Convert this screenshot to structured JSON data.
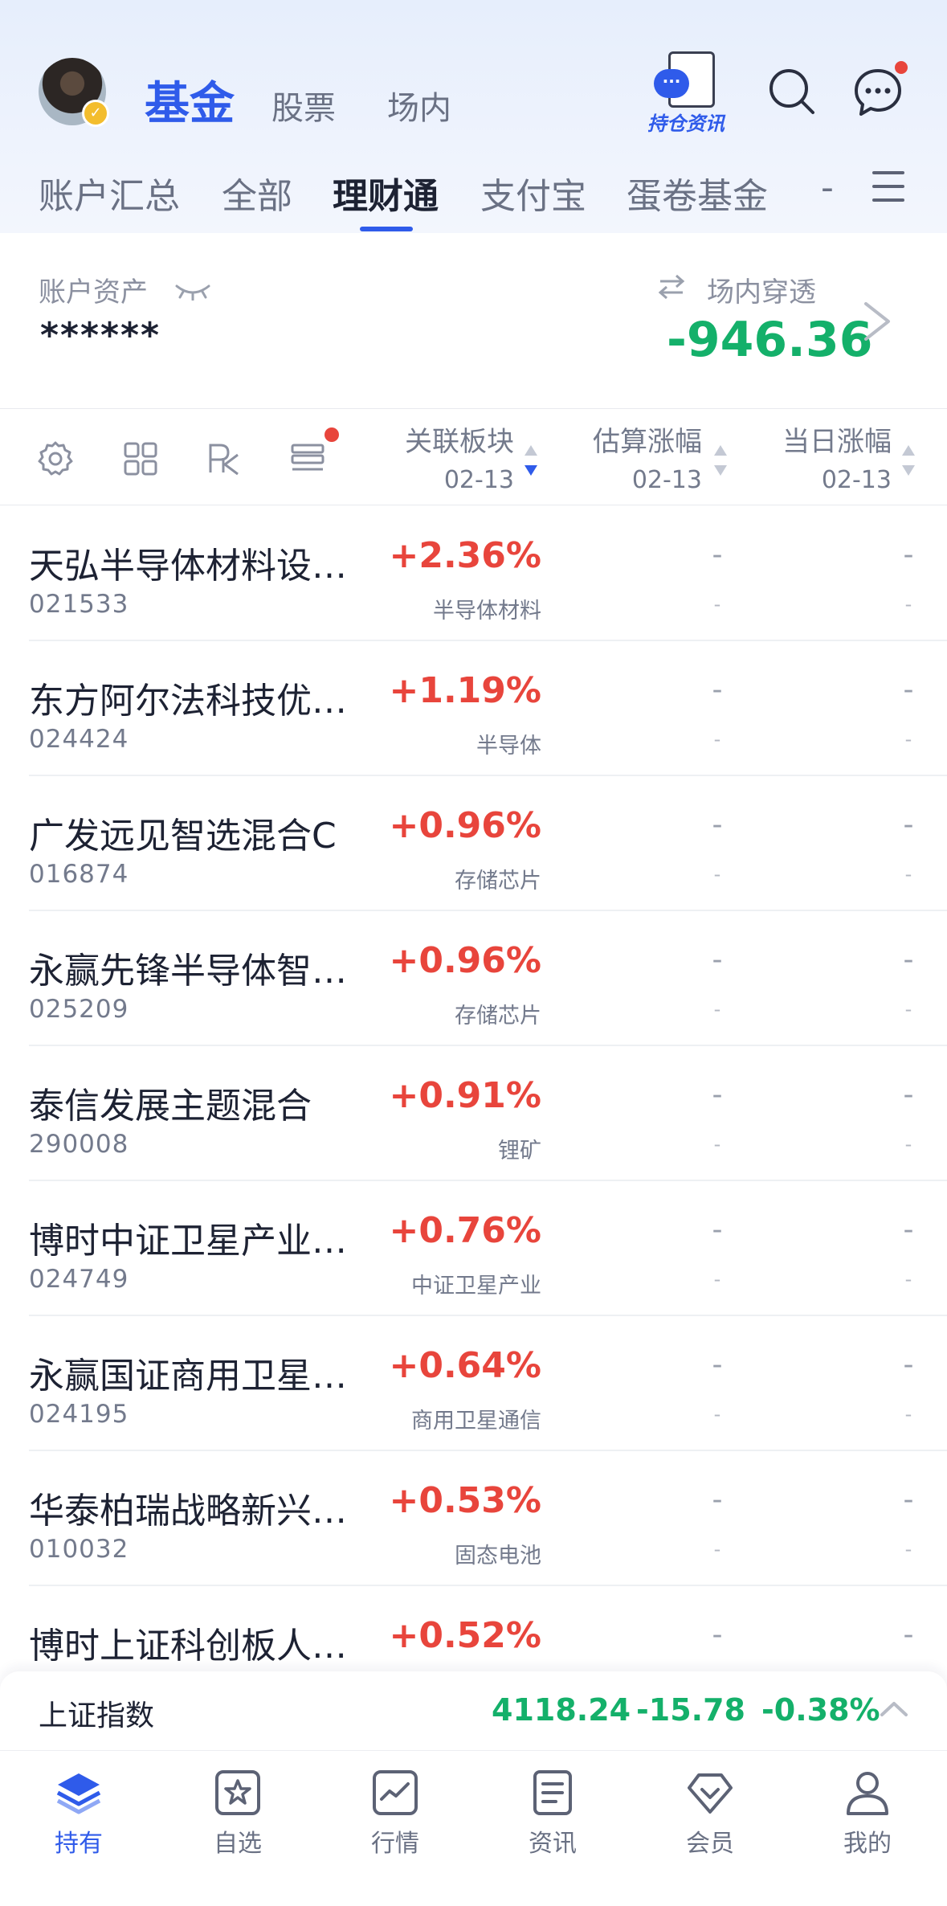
{
  "header": {
    "tabs": [
      "基金",
      "股票",
      "场内"
    ],
    "holdings_news_label": "持仓资讯",
    "account_tabs": [
      "账户汇总",
      "全部",
      "理财通",
      "支付宝",
      "蛋卷基金",
      "-"
    ]
  },
  "assets": {
    "label": "账户资产",
    "value": "******",
    "penetrate_label": "场内穿透",
    "penetrate_value": "-946.36"
  },
  "table": {
    "columns": [
      {
        "label": "关联板块",
        "date": "02-13"
      },
      {
        "label": "估算涨幅",
        "date": "02-13"
      },
      {
        "label": "当日涨幅",
        "date": "02-13"
      }
    ],
    "rows": [
      {
        "name": "天弘半导体材料设…",
        "code": "021533",
        "change": "+2.36%",
        "sector": "半导体材料",
        "est": "-",
        "est_sub": "-",
        "day": "-",
        "day_sub": "-"
      },
      {
        "name": "东方阿尔法科技优…",
        "code": "024424",
        "change": "+1.19%",
        "sector": "半导体",
        "est": "-",
        "est_sub": "-",
        "day": "-",
        "day_sub": "-"
      },
      {
        "name": "广发远见智选混合C",
        "code": "016874",
        "change": "+0.96%",
        "sector": "存储芯片",
        "est": "-",
        "est_sub": "-",
        "day": "-",
        "day_sub": "-"
      },
      {
        "name": "永赢先锋半导体智…",
        "code": "025209",
        "change": "+0.96%",
        "sector": "存储芯片",
        "est": "-",
        "est_sub": "-",
        "day": "-",
        "day_sub": "-"
      },
      {
        "name": "泰信发展主题混合",
        "code": "290008",
        "change": "+0.91%",
        "sector": "锂矿",
        "est": "-",
        "est_sub": "-",
        "day": "-",
        "day_sub": "-"
      },
      {
        "name": "博时中证卫星产业…",
        "code": "024749",
        "change": "+0.76%",
        "sector": "中证卫星产业",
        "est": "-",
        "est_sub": "-",
        "day": "-",
        "day_sub": "-"
      },
      {
        "name": "永赢国证商用卫星…",
        "code": "024195",
        "change": "+0.64%",
        "sector": "商用卫星通信",
        "est": "-",
        "est_sub": "-",
        "day": "-",
        "day_sub": "-"
      },
      {
        "name": "华泰柏瑞战略新兴…",
        "code": "010032",
        "change": "+0.53%",
        "sector": "固态电池",
        "est": "-",
        "est_sub": "-",
        "day": "-",
        "day_sub": "-"
      },
      {
        "name": "博时上证科创板人…",
        "code": "",
        "change": "+0.52%",
        "sector": "",
        "est": "-",
        "est_sub": "",
        "day": "-",
        "day_sub": ""
      }
    ]
  },
  "index": {
    "name": "上证指数",
    "value": "4118.24",
    "change": "-15.78",
    "percent": "-0.38%"
  },
  "bottom_nav": [
    {
      "label": "持有",
      "icon": "layers-icon"
    },
    {
      "label": "自选",
      "icon": "star-icon"
    },
    {
      "label": "行情",
      "icon": "chart-icon"
    },
    {
      "label": "资讯",
      "icon": "news-icon"
    },
    {
      "label": "会员",
      "icon": "diamond-icon"
    },
    {
      "label": "我的",
      "icon": "person-icon"
    }
  ],
  "colors": {
    "accent": "#2f5bea",
    "rise": "#e8453c",
    "fall": "#14b06a"
  }
}
